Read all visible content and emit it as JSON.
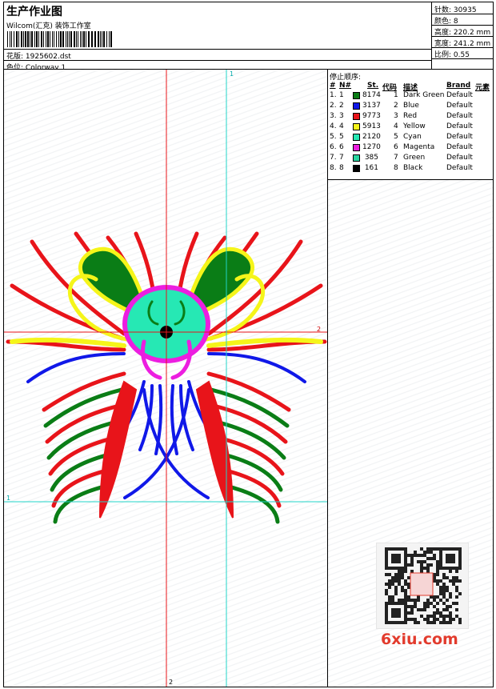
{
  "header": {
    "title": "生产作业图",
    "company": "Wilcom(汇克) 装饰工作室",
    "design_label": "花版:",
    "design_value": "1925602.dst",
    "colorway_label": "色位:",
    "colorway_value": "Colorway 1"
  },
  "stats": {
    "stitches_label": "针数:",
    "stitches_value": "30935",
    "colors_label": "颜色:",
    "colors_value": "8",
    "height_label": "高度:",
    "height_value": "220.2 mm",
    "width_label": "宽度:",
    "width_value": "241.2 mm",
    "scale_label": "比例:",
    "scale_value": "0.55"
  },
  "stop_sequence": {
    "title": "停止顺序:",
    "columns": {
      "num": "#",
      "n": "N#",
      "st": "St.",
      "code": "代码",
      "desc": "描述",
      "brand": "Brand",
      "element": "元素"
    },
    "rows": [
      {
        "num": "1.",
        "n": "1",
        "color": "#0a7d16",
        "st": "8174",
        "code": "1",
        "desc": "Dark Green",
        "brand": "Default"
      },
      {
        "num": "2.",
        "n": "2",
        "color": "#1018e8",
        "st": "3137",
        "code": "2",
        "desc": "Blue",
        "brand": "Default"
      },
      {
        "num": "3.",
        "n": "3",
        "color": "#e8141a",
        "st": "9773",
        "code": "3",
        "desc": "Red",
        "brand": "Default"
      },
      {
        "num": "4.",
        "n": "4",
        "color": "#f5f51a",
        "st": "5913",
        "code": "4",
        "desc": "Yellow",
        "brand": "Default"
      },
      {
        "num": "5.",
        "n": "5",
        "color": "#26e8b4",
        "st": "2120",
        "code": "5",
        "desc": "Cyan",
        "brand": "Default"
      },
      {
        "num": "6.",
        "n": "6",
        "color": "#ec1ee0",
        "st": "1270",
        "code": "6",
        "desc": "Magenta",
        "brand": "Default"
      },
      {
        "num": "7.",
        "n": "7",
        "color": "#2ad6a0",
        "st": "385",
        "code": "7",
        "desc": "Green",
        "brand": "Default"
      },
      {
        "num": "8.",
        "n": "8",
        "color": "#000000",
        "st": "161",
        "code": "8",
        "desc": "Black",
        "brand": "Default"
      }
    ]
  },
  "guides": {
    "vertical_red": "2",
    "horizontal_red": "2",
    "vertical_cyan": "1",
    "horizontal_cyan": "1"
  },
  "watermark": {
    "site": "6xiu.com"
  },
  "colors": {
    "guide_red": "#e8141a",
    "guide_cyan": "#22d4c8",
    "dark_green": "#0a7d16",
    "blue": "#1018e8",
    "red": "#e8141a",
    "yellow": "#f5f51a",
    "cyan": "#26e8b4",
    "magenta": "#ec1ee0",
    "black": "#000000"
  }
}
